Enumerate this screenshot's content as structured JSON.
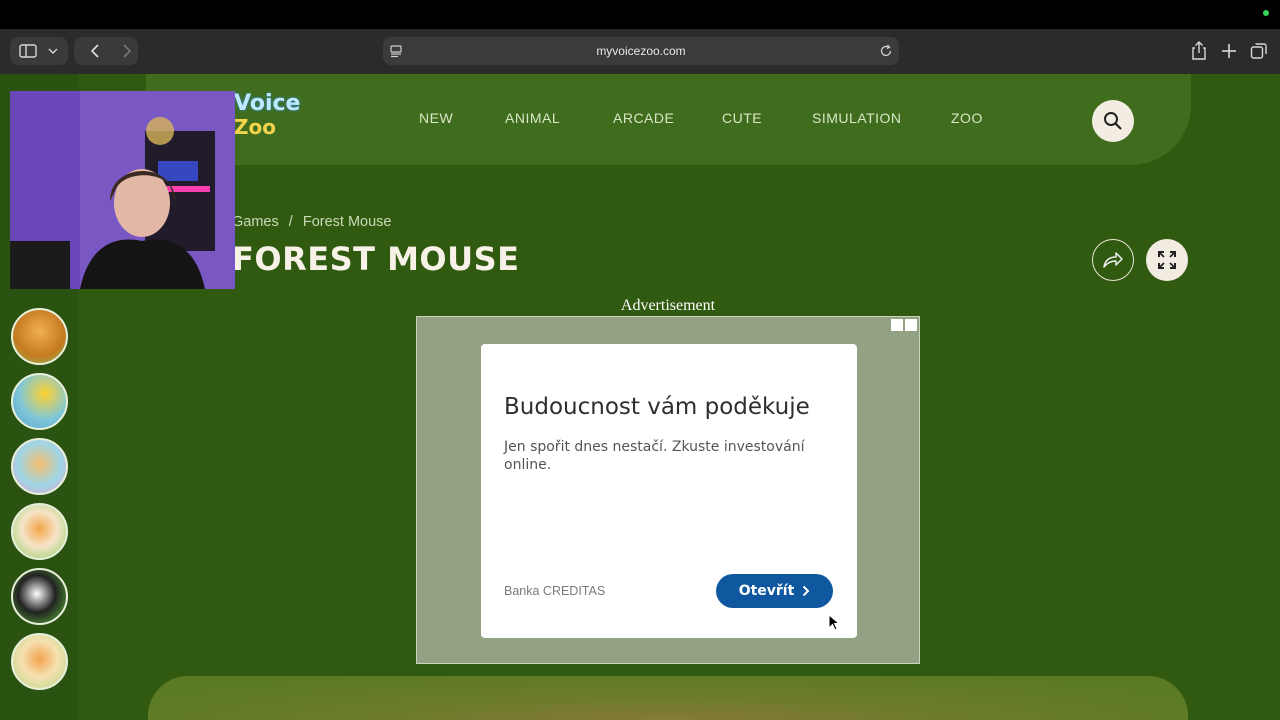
{
  "browser": {
    "url": "myvoicezoo.com"
  },
  "site": {
    "logo_text_top": "Voice",
    "logo_text_bottom": "Zoo",
    "nav": [
      "NEW",
      "ANIMAL",
      "ARCADE",
      "CUTE",
      "SIMULATION",
      "ZOO"
    ]
  },
  "page": {
    "breadcrumb_parent": "Games",
    "breadcrumb_sep": "/",
    "breadcrumb_current": "Forest Mouse",
    "title": "FOREST MOUSE"
  },
  "ad": {
    "label": "Advertisement",
    "headline": "Budoucnost vám poděkuje",
    "body": "Jen spořit dnes nestačí. Zkuste investování online.",
    "advertiser": "Banka CREDITAS",
    "cta": "Otevřít"
  },
  "colors": {
    "page_bg": "#2f5a0f",
    "header_bg": "#3f6d1d",
    "cta_bg": "#0f579e"
  }
}
